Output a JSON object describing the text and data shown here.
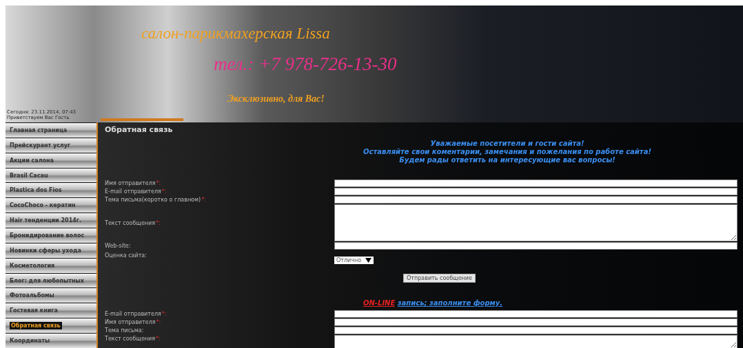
{
  "header": {
    "title": "салон-парикмахерская Lissa",
    "phone": "тел.: +7 978-726-13-30",
    "slogan": "Эксклюзивно, для Вас!",
    "date": "Сегодня: 23.11.2014, 07:43",
    "greeting": "Приветствуем Вас Гость"
  },
  "sidebar": {
    "items": [
      {
        "label": "Главная страница",
        "selected": false
      },
      {
        "label": "Прейскурант услуг",
        "selected": false
      },
      {
        "label": "Акции салона",
        "selected": false
      },
      {
        "label": "Brasil Cacau",
        "selected": false
      },
      {
        "label": "Plastica dos Fios",
        "selected": false
      },
      {
        "label": "CocoChoco - кератин",
        "selected": false
      },
      {
        "label": "Hair тенденции 2014г.",
        "selected": false
      },
      {
        "label": "Бронидирование волос",
        "selected": false
      },
      {
        "label": "Новинки сферы ухода",
        "selected": false
      },
      {
        "label": "Косметология",
        "selected": false
      },
      {
        "label": "Блог: для любопытных",
        "selected": false
      },
      {
        "label": "Фотоальбомы",
        "selected": false
      },
      {
        "label": "Гостевая книга",
        "selected": false
      },
      {
        "label": "Обратная связь",
        "selected": true
      },
      {
        "label": "Координаты",
        "selected": false
      }
    ]
  },
  "content": {
    "title": "Обратная связь",
    "intro": [
      "Уважаемые посетители и гости сайта!",
      "Оставляйте свои коментарии, замечания и пожелания по работе сайта!",
      "Будем рады ответить на интересующие вас вопросы!"
    ],
    "feedback_form": [
      {
        "kind": "text",
        "label": "Имя отправителя",
        "mark": "*:"
      },
      {
        "kind": "text",
        "label": "E-mail отправителя",
        "mark": "*:"
      },
      {
        "kind": "text",
        "label": "Тема письма(коротко о главном)",
        "mark": "*:"
      },
      {
        "kind": "textarea",
        "label": "Текст сообщения",
        "mark": "*:"
      },
      {
        "kind": "text",
        "label": "Web-site:"
      },
      {
        "kind": "select",
        "label": "Оценка сайта:",
        "value": "Отлично"
      },
      {
        "kind": "button",
        "label": "Отправить сообщение"
      }
    ],
    "booking_heading": {
      "highlight": "ON-LINE",
      "text": "запись; заполните форму."
    },
    "booking_form": [
      {
        "kind": "text",
        "label": "E-mail отправителя",
        "mark": "*:"
      },
      {
        "kind": "text",
        "label": "Имя отправителя",
        "mark": "*:"
      },
      {
        "kind": "text",
        "label": "Тема письма:"
      },
      {
        "kind": "textarea",
        "label": "Текст сообщения",
        "mark": "*:"
      }
    ]
  }
}
